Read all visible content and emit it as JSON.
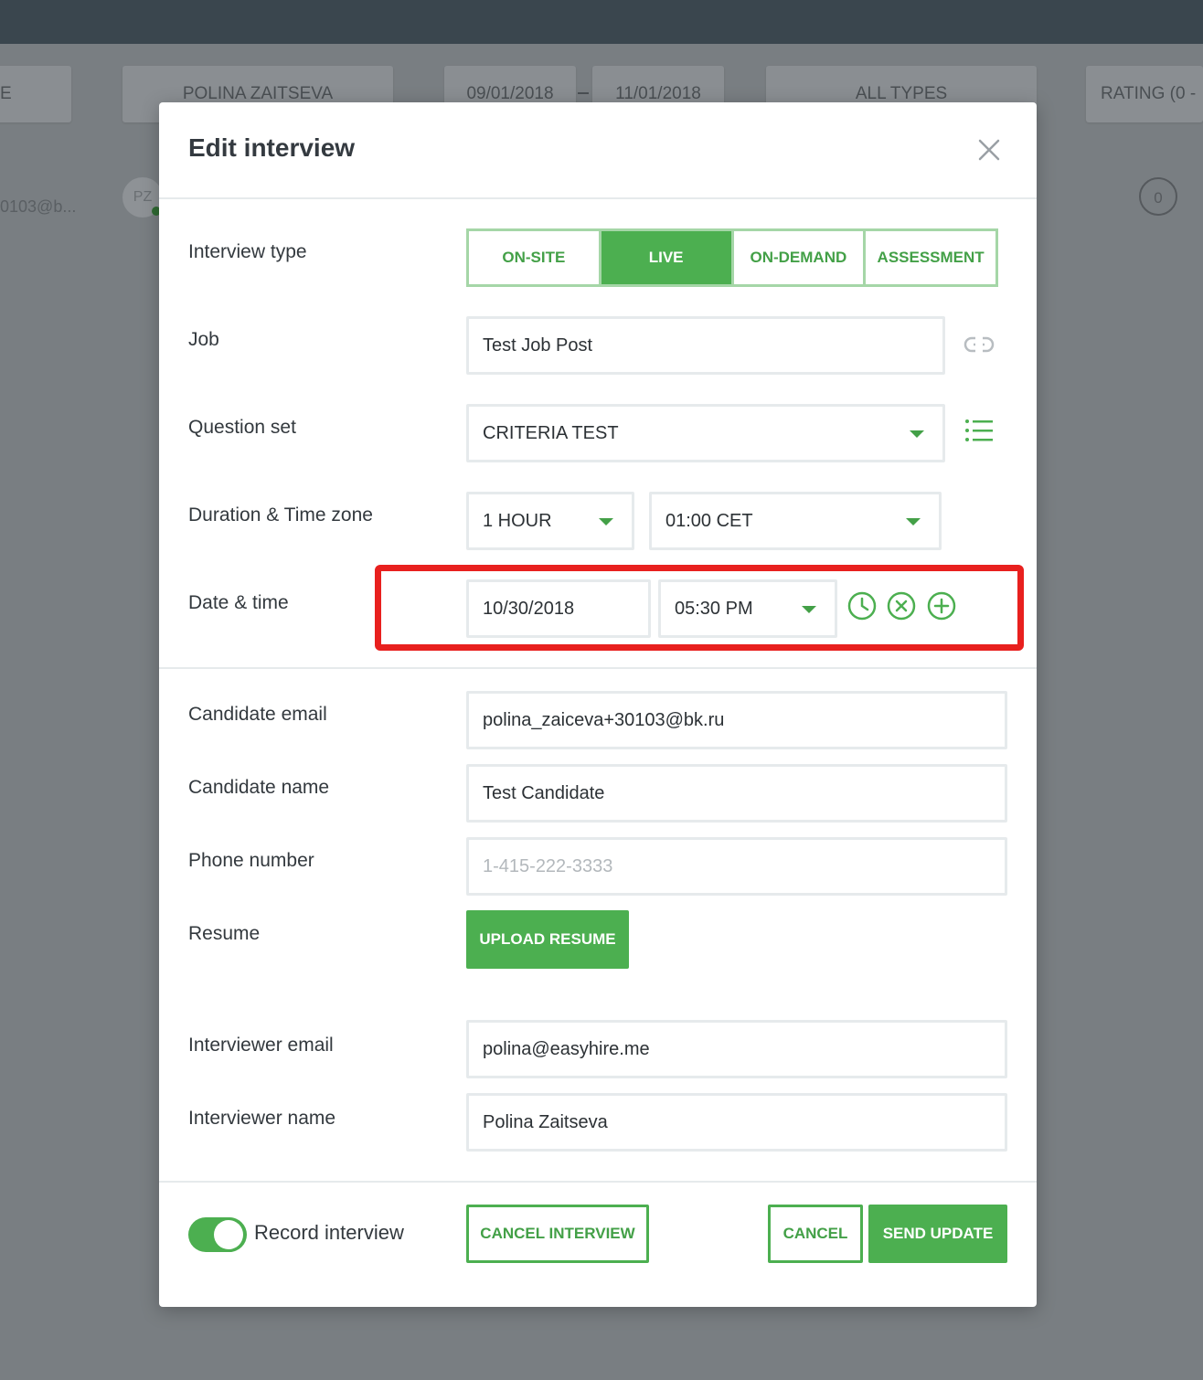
{
  "background": {
    "filters": {
      "first_partial": "E",
      "interviewer": "POLINA ZAITSEVA",
      "date_from": "09/01/2018",
      "date_to": "11/01/2018",
      "type": "ALL TYPES",
      "rating": "RATING (0 -"
    },
    "row": {
      "email_partial": "0103@b...",
      "avatar_initials": "PZ",
      "rating_value": "0"
    }
  },
  "modal": {
    "title": "Edit interview",
    "interview_type": {
      "label": "Interview type",
      "options": [
        "ON-SITE",
        "LIVE",
        "ON-DEMAND",
        "ASSESSMENT"
      ],
      "selected": "LIVE"
    },
    "job": {
      "label": "Job",
      "value": "Test Job Post"
    },
    "question_set": {
      "label": "Question set",
      "value": "CRITERIA TEST"
    },
    "duration_timezone": {
      "label": "Duration & Time zone",
      "duration": "1 HOUR",
      "timezone": "01:00 CET"
    },
    "date_time": {
      "label": "Date & time",
      "date": "10/30/2018",
      "time": "05:30 PM"
    },
    "candidate_email": {
      "label": "Candidate email",
      "value": "polina_zaiceva+30103@bk.ru"
    },
    "candidate_name": {
      "label": "Candidate name",
      "value": "Test Candidate"
    },
    "phone_number": {
      "label": "Phone number",
      "placeholder": "1-415-222-3333"
    },
    "resume": {
      "label": "Resume",
      "button": "UPLOAD RESUME"
    },
    "interviewer_email": {
      "label": "Interviewer email",
      "value": "polina@easyhire.me"
    },
    "interviewer_name": {
      "label": "Interviewer name",
      "value": "Polina Zaitseva"
    },
    "footer": {
      "record_label": "Record interview",
      "record_on": true,
      "cancel_interview": "CANCEL INTERVIEW",
      "cancel": "CANCEL",
      "send_update": "SEND UPDATE"
    },
    "colors": {
      "accent": "#4caf50",
      "accent_light": "#a5d6a7",
      "highlight": "#e8201e"
    }
  }
}
